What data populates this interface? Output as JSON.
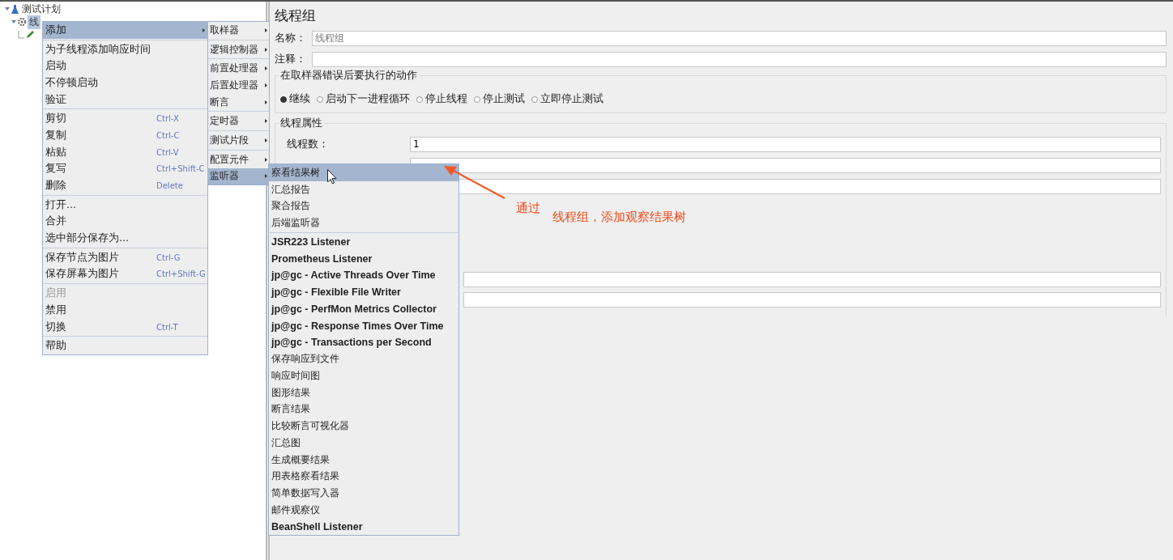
{
  "tree": [
    {
      "label": "测试计划",
      "selected": false,
      "children": [
        {
          "label": "线",
          "selected": true,
          "children": [
            {
              "selected": false
            }
          ]
        }
      ]
    }
  ],
  "panel": {
    "title": "线程组",
    "name_field": {
      "label": "名称：",
      "value": "线程组"
    },
    "comment_field": {
      "label": "注释："
    },
    "error_action": {
      "legend": "在取样器错误后要执行的动作",
      "options": [
        {
          "label": "继续",
          "selected": true
        },
        {
          "label": "启动下一进程循环",
          "selected": false
        },
        {
          "label": "停止线程",
          "selected": false
        },
        {
          "label": "停止测试",
          "selected": false
        },
        {
          "label": "立即停止测试",
          "selected": false
        }
      ]
    },
    "thread_props": {
      "legend": "线程属性",
      "threads_label": "线程数：",
      "threads_value": "1"
    }
  },
  "context_menu": {
    "sections": [
      [
        {
          "label": "添加",
          "submenu": true,
          "selected": true,
          "disabled": false
        }
      ],
      [
        {
          "label": "为子线程添加响应时间",
          "submenu": false,
          "selected": false,
          "disabled": false
        },
        {
          "label": "启动",
          "submenu": false,
          "selected": false,
          "disabled": false
        },
        {
          "label": "不停顿启动",
          "submenu": false,
          "selected": false,
          "disabled": false
        },
        {
          "label": "验证",
          "submenu": false,
          "selected": false,
          "disabled": false
        }
      ],
      [
        {
          "label": "剪切",
          "shortcut": "Ctrl-X",
          "submenu": false,
          "selected": false,
          "disabled": false
        },
        {
          "label": "复制",
          "shortcut": "Ctrl-C",
          "submenu": false,
          "selected": false,
          "disabled": false
        },
        {
          "label": "粘贴",
          "shortcut": "Ctrl-V",
          "submenu": false,
          "selected": false,
          "disabled": false
        },
        {
          "label": "复写",
          "shortcut": "Ctrl+Shift-C",
          "submenu": false,
          "selected": false,
          "disabled": false
        },
        {
          "label": "删除",
          "shortcut": "Delete",
          "submenu": false,
          "selected": false,
          "disabled": false
        }
      ],
      [
        {
          "label": "打开...",
          "submenu": false,
          "selected": false,
          "disabled": false
        },
        {
          "label": "合并",
          "submenu": false,
          "selected": false,
          "disabled": false
        },
        {
          "label": "选中部分保存为...",
          "submenu": false,
          "selected": false,
          "disabled": false
        }
      ],
      [
        {
          "label": "保存节点为图片",
          "shortcut": "Ctrl-G",
          "submenu": false,
          "selected": false,
          "disabled": false
        },
        {
          "label": "保存屏幕为图片",
          "shortcut": "Ctrl+Shift-G",
          "submenu": false,
          "selected": false,
          "disabled": false
        }
      ],
      [
        {
          "label": "启用",
          "submenu": false,
          "selected": false,
          "disabled": true
        },
        {
          "label": "禁用",
          "submenu": false,
          "selected": false,
          "disabled": false
        },
        {
          "label": "切换",
          "shortcut": "Ctrl-T",
          "submenu": false,
          "selected": false,
          "disabled": false
        }
      ],
      [
        {
          "label": "帮助",
          "submenu": false,
          "selected": false,
          "disabled": false
        }
      ]
    ]
  },
  "add_submenu": {
    "sections": [
      [
        {
          "label": "取样器",
          "selected": false
        }
      ],
      [
        {
          "label": "逻辑控制器",
          "selected": false
        }
      ],
      [
        {
          "label": "前置处理器",
          "selected": false
        },
        {
          "label": "后置处理器",
          "selected": false
        },
        {
          "label": "断言",
          "selected": false
        }
      ],
      [
        {
          "label": "定时器",
          "selected": false
        }
      ],
      [
        {
          "label": "测试片段",
          "selected": false
        }
      ],
      [
        {
          "label": "配置元件",
          "selected": false
        },
        {
          "label": "监听器",
          "selected": true
        }
      ]
    ]
  },
  "listener_submenu": {
    "sections": [
      [
        {
          "label": "察看结果树",
          "bold": false,
          "selected": true
        },
        {
          "label": "汇总报告",
          "bold": false,
          "selected": false
        },
        {
          "label": "聚合报告",
          "bold": false,
          "selected": false
        },
        {
          "label": "后端监听器",
          "bold": false,
          "selected": false
        }
      ],
      [
        {
          "label": "JSR223 Listener",
          "bold": true,
          "selected": false
        },
        {
          "label": "Prometheus Listener",
          "bold": true,
          "selected": false
        },
        {
          "label": "jp@gc - Active Threads Over Time",
          "bold": true,
          "selected": false
        },
        {
          "label": "jp@gc - Flexible File Writer",
          "bold": true,
          "selected": false
        },
        {
          "label": "jp@gc - PerfMon Metrics Collector",
          "bold": true,
          "selected": false
        },
        {
          "label": "jp@gc - Response Times Over Time",
          "bold": true,
          "selected": false
        },
        {
          "label": "jp@gc - Transactions per Second",
          "bold": true,
          "selected": false
        },
        {
          "label": "保存响应到文件",
          "bold": false,
          "selected": false
        },
        {
          "label": "响应时间图",
          "bold": false,
          "selected": false
        },
        {
          "label": "图形结果",
          "bold": false,
          "selected": false
        },
        {
          "label": "断言结果",
          "bold": false,
          "selected": false
        },
        {
          "label": "比较断言可视化器",
          "bold": false,
          "selected": false
        },
        {
          "label": "汇总图",
          "bold": false,
          "selected": false
        },
        {
          "label": "生成概要结果",
          "bold": false,
          "selected": false
        },
        {
          "label": "用表格察看结果",
          "bold": false,
          "selected": false
        },
        {
          "label": "简单数据写入器",
          "bold": false,
          "selected": false
        },
        {
          "label": "邮件观察仪",
          "bold": false,
          "selected": false
        },
        {
          "label": "BeanShell Listener",
          "bold": true,
          "selected": false
        }
      ]
    ]
  },
  "annotation": {
    "lead": "通过",
    "text": "线程组，添加观察结果树"
  }
}
